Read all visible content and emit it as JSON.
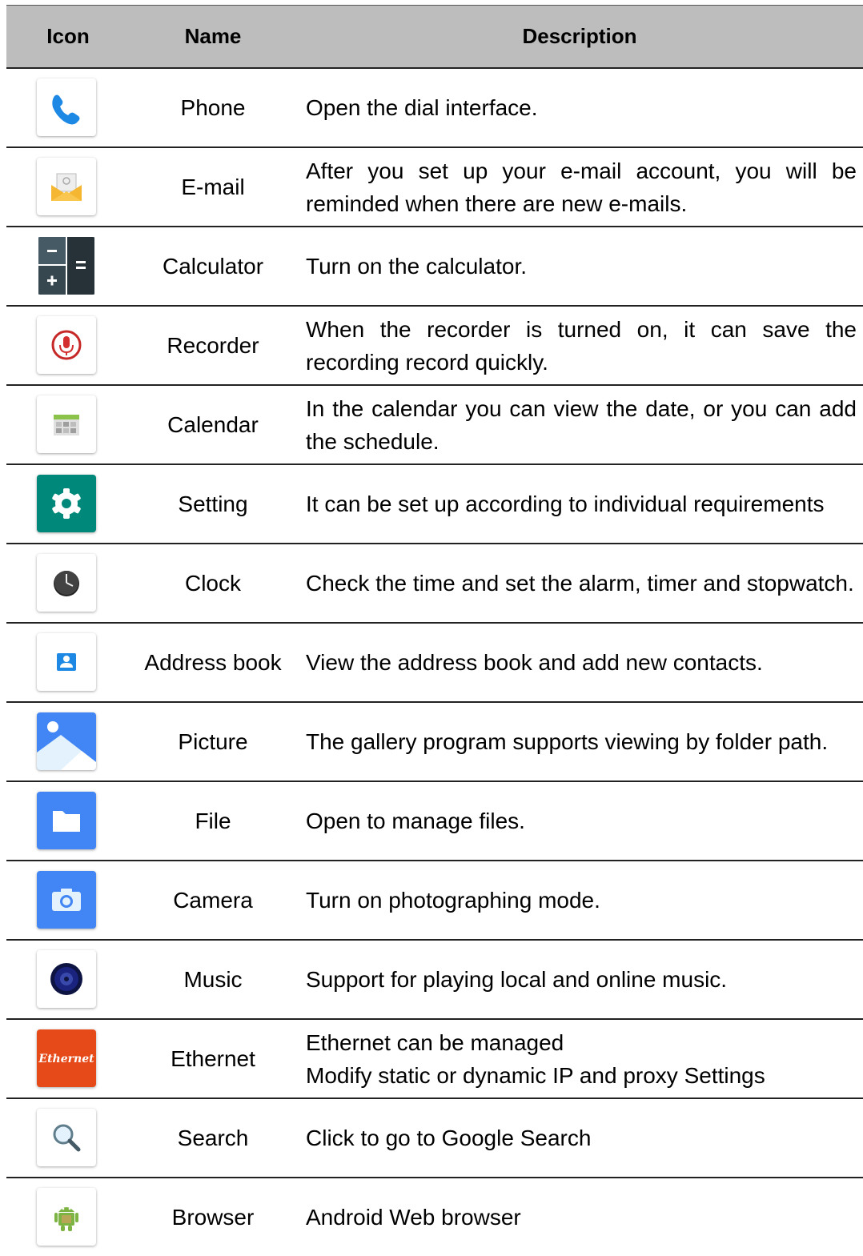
{
  "headers": {
    "icon": "Icon",
    "name": "Name",
    "description": "Description"
  },
  "rows": [
    {
      "icon": "phone-icon",
      "name": "Phone",
      "description": "Open the dial interface."
    },
    {
      "icon": "email-icon",
      "name": "E-mail",
      "description": "After you set up your e-mail account, you will be reminded when there are new e-mails."
    },
    {
      "icon": "calculator-icon",
      "name": "Calculator",
      "description": "Turn on the calculator."
    },
    {
      "icon": "recorder-icon",
      "name": "Recorder",
      "description": "When the recorder is turned on, it can save the recording record quickly."
    },
    {
      "icon": "calendar-icon",
      "name": "Calendar",
      "description": "In the calendar you can view the date, or you can add the schedule."
    },
    {
      "icon": "settings-gear-icon",
      "name": "Setting",
      "description": "It can be set up according to individual requirements"
    },
    {
      "icon": "clock-icon",
      "name": "Clock",
      "description": "Check the time and set the alarm, timer and stopwatch."
    },
    {
      "icon": "address-book-icon",
      "name": "Address book",
      "description": "View the address book and add new contacts."
    },
    {
      "icon": "picture-icon",
      "name": "Picture",
      "description": "The gallery program supports viewing by folder path."
    },
    {
      "icon": "folder-icon",
      "name": "File",
      "description": "Open to manage files."
    },
    {
      "icon": "camera-icon",
      "name": "Camera",
      "description": "Turn on photographing mode."
    },
    {
      "icon": "music-speaker-icon",
      "name": "Music",
      "description": "Support for playing local and online music."
    },
    {
      "icon": "ethernet-icon",
      "icon_text": "Ethernet",
      "name": "Ethernet",
      "description": "Ethernet can be managed\nModify static or dynamic IP and proxy Settings"
    },
    {
      "icon": "search-magnifier-icon",
      "name": "Search",
      "description": "Click to go to Google Search"
    },
    {
      "icon": "android-browser-icon",
      "name": "Browser",
      "description": "Android Web browser"
    }
  ],
  "colors": {
    "header_bg": "#bdbdbd",
    "phone": "#1e88e5",
    "email": "#f5b731",
    "calculator": "#37474f",
    "recorder": "#d32f2f",
    "calendar": "#8bc34a",
    "settings": "#00897b",
    "clock": "#424242",
    "address_book": "#1e88e5",
    "picture": "#4285f4",
    "file": "#4285f4",
    "camera": "#4285f4",
    "music": "#1a237e",
    "ethernet": "#e64a19",
    "android": "#7cb342"
  }
}
